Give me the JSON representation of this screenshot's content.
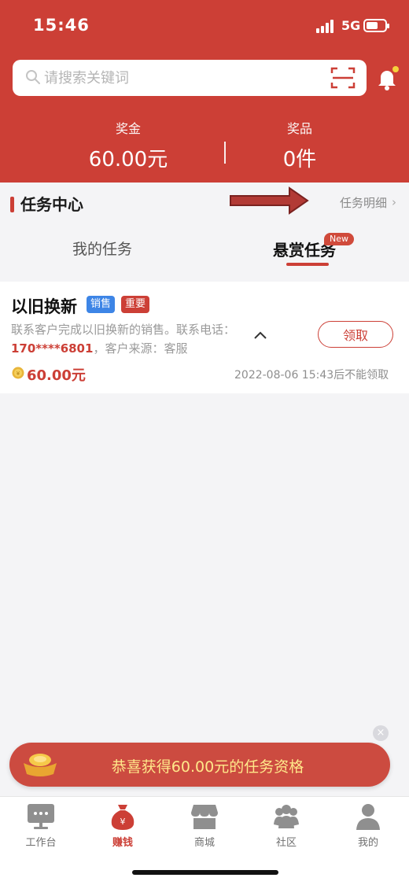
{
  "status_bar": {
    "time": "15:46",
    "network": "5G"
  },
  "search": {
    "placeholder": "请搜索关键词"
  },
  "stats": [
    {
      "label": "奖金",
      "value": "60.00元"
    },
    {
      "label": "奖品",
      "value": "0件"
    }
  ],
  "task_center": {
    "title": "任务中心",
    "detail_link": "任务明细"
  },
  "tabs": [
    {
      "label": "我的任务",
      "active": false
    },
    {
      "label": "悬赏任务",
      "active": true,
      "badge": "New"
    }
  ],
  "task": {
    "title": "以旧换新",
    "tags": [
      "销售",
      "重要"
    ],
    "description_line1": "联系客户完成以旧换新的销售。联系电话：",
    "phone": "170****6801",
    "description_line2_rest": "，客户来源：客服",
    "claim_label": "领取",
    "reward": "60.00元",
    "deadline": "2022-08-06 15:43后不能领取"
  },
  "banner": {
    "text": "恭喜获得60.00元的任务资格",
    "close": "×"
  },
  "bottom_nav": [
    {
      "label": "工作台",
      "icon": "workbench-icon",
      "active": false
    },
    {
      "label": "赚钱",
      "icon": "money-bag-icon",
      "active": true
    },
    {
      "label": "商城",
      "icon": "store-icon",
      "active": false
    },
    {
      "label": "社区",
      "icon": "community-icon",
      "active": false
    },
    {
      "label": "我的",
      "icon": "profile-icon",
      "active": false
    }
  ],
  "colors": {
    "primary": "#cc3f36",
    "tag_blue": "#3d85e6",
    "banner_text": "#ffe88a"
  }
}
